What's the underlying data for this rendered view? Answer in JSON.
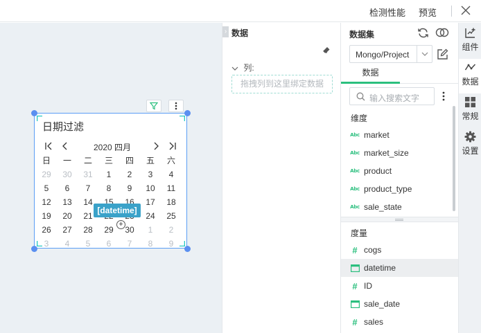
{
  "topbar": {
    "detect_label": "检测性能",
    "preview_label": "预览"
  },
  "widget": {
    "title": "日期过滤",
    "calendar": {
      "year_month": "2020 四月",
      "weekdays": [
        "日",
        "一",
        "二",
        "三",
        "四",
        "五",
        "六"
      ],
      "weeks": [
        [
          "29",
          "30",
          "31",
          "1",
          "2",
          "3",
          "4"
        ],
        [
          "5",
          "6",
          "7",
          "8",
          "9",
          "10",
          "11"
        ],
        [
          "12",
          "13",
          "14",
          "15",
          "16",
          "17",
          "18"
        ],
        [
          "19",
          "20",
          "21",
          "22",
          "23",
          "24",
          "25"
        ],
        [
          "26",
          "27",
          "28",
          "29",
          "30",
          "1",
          "2"
        ],
        [
          "3",
          "4",
          "5",
          "6",
          "7",
          "8",
          "9"
        ]
      ],
      "muted_cells": [
        "0-0",
        "0-1",
        "0-2",
        "4-5",
        "4-6",
        "5-0",
        "5-1",
        "5-2",
        "5-3",
        "5-4",
        "5-5",
        "5-6"
      ]
    },
    "drag_tag": "[datetime]"
  },
  "column_panel": {
    "title": "数据",
    "columns_label": "列:",
    "drop_placeholder": "拖拽列到这里绑定数据"
  },
  "dataset_panel": {
    "title": "数据集",
    "selected_dataset": "Mongo/Project",
    "tab_label": "数据",
    "search_placeholder": "输入搜索文字",
    "dimensions_title": "维度",
    "dimensions": [
      {
        "name": "market",
        "type": "text"
      },
      {
        "name": "market_size",
        "type": "text"
      },
      {
        "name": "product",
        "type": "text"
      },
      {
        "name": "product_type",
        "type": "text"
      },
      {
        "name": "sale_state",
        "type": "text"
      }
    ],
    "measures_title": "度量",
    "measures": [
      {
        "name": "cogs",
        "type": "number"
      },
      {
        "name": "datetime",
        "type": "date"
      },
      {
        "name": "ID",
        "type": "number"
      },
      {
        "name": "sale_date",
        "type": "date"
      },
      {
        "name": "sales",
        "type": "number"
      }
    ],
    "selected_field": "datetime",
    "text_type_marker": "Abc",
    "number_type_marker": "#"
  },
  "rail": {
    "items": [
      {
        "label": "组件",
        "icon": "add-chart-icon"
      },
      {
        "label": "数据",
        "icon": "data-line-icon"
      },
      {
        "label": "常规",
        "icon": "grid-icon"
      },
      {
        "label": "设置",
        "icon": "gear-icon"
      }
    ]
  },
  "colors": {
    "accent_green": "#2bbf7e",
    "selection_blue": "#5a9df5",
    "tag_blue": "#3aa2c9",
    "canvas_bg": "#ebf0f4"
  }
}
